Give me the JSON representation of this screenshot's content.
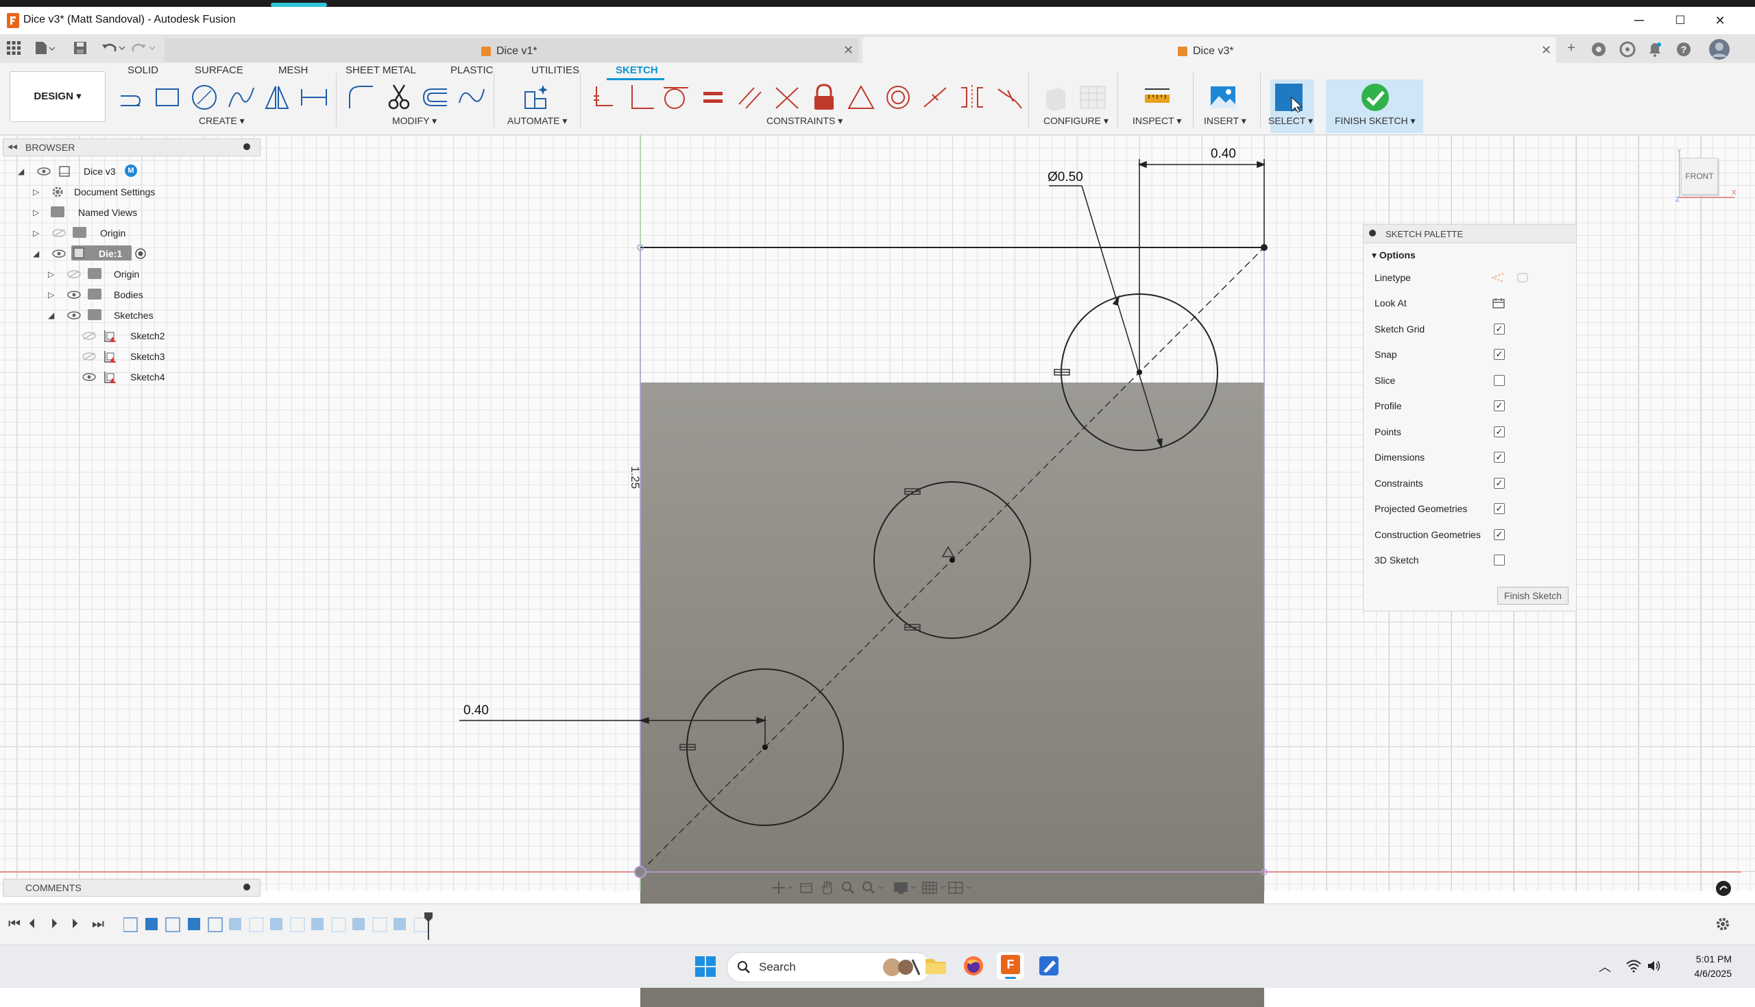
{
  "window": {
    "title": "Dice v3* (Matt Sandoval) - Autodesk Fusion",
    "minimize": "─",
    "maximize": "☐",
    "close": "✕"
  },
  "doc_tabs": [
    {
      "label": "Dice v1*",
      "active": false
    },
    {
      "label": "Dice v3*",
      "active": true
    }
  ],
  "ribbon": {
    "tabs": [
      "SOLID",
      "SURFACE",
      "MESH",
      "SHEET METAL",
      "PLASTIC",
      "UTILITIES",
      "SKETCH"
    ],
    "active_tab": "SKETCH",
    "workspace": "DESIGN ▾",
    "groups": [
      "CREATE ▾",
      "MODIFY ▾",
      "AUTOMATE ▾",
      "CONSTRAINTS ▾",
      "CONFIGURE ▾",
      "INSPECT ▾",
      "INSERT ▾",
      "SELECT ▾",
      "FINISH SKETCH ▾"
    ]
  },
  "browser": {
    "header": "BROWSER",
    "items": [
      {
        "label": "Dice v3",
        "level": 0
      },
      {
        "label": "Document Settings",
        "level": 1
      },
      {
        "label": "Named Views",
        "level": 1
      },
      {
        "label": "Origin",
        "level": 1
      },
      {
        "label": "Die:1",
        "level": 1
      },
      {
        "label": "Origin",
        "level": 2
      },
      {
        "label": "Bodies",
        "level": 2
      },
      {
        "label": "Sketches",
        "level": 2
      },
      {
        "label": "Sketch2",
        "level": 3
      },
      {
        "label": "Sketch3",
        "level": 3
      },
      {
        "label": "Sketch4",
        "level": 3
      }
    ]
  },
  "sketch": {
    "dim_top": "0.40",
    "dim_diameter": "Ø0.50",
    "dim_left": "0.40",
    "dim_vertical": "1.25"
  },
  "viewcube": {
    "face": "FRONT"
  },
  "palette": {
    "header": "SKETCH PALETTE",
    "section": "Options",
    "options": [
      {
        "label": "Linetype",
        "type": "icons"
      },
      {
        "label": "Look At",
        "type": "icon"
      },
      {
        "label": "Sketch Grid",
        "checked": true
      },
      {
        "label": "Snap",
        "checked": true
      },
      {
        "label": "Slice",
        "checked": false
      },
      {
        "label": "Profile",
        "checked": true
      },
      {
        "label": "Points",
        "checked": true
      },
      {
        "label": "Dimensions",
        "checked": true
      },
      {
        "label": "Constraints",
        "checked": true
      },
      {
        "label": "Projected Geometries",
        "checked": true
      },
      {
        "label": "Construction Geometries",
        "checked": true
      },
      {
        "label": "3D Sketch",
        "checked": false
      }
    ],
    "finish_button": "Finish Sketch"
  },
  "comments": {
    "header": "COMMENTS"
  },
  "taskbar": {
    "search_placeholder": "Search",
    "time": "5:01 PM",
    "date": "4/6/2025"
  },
  "colors": {
    "accent": "#0696d7",
    "profile_fill": "#8a8880",
    "finish_green": "#2fb24a"
  }
}
